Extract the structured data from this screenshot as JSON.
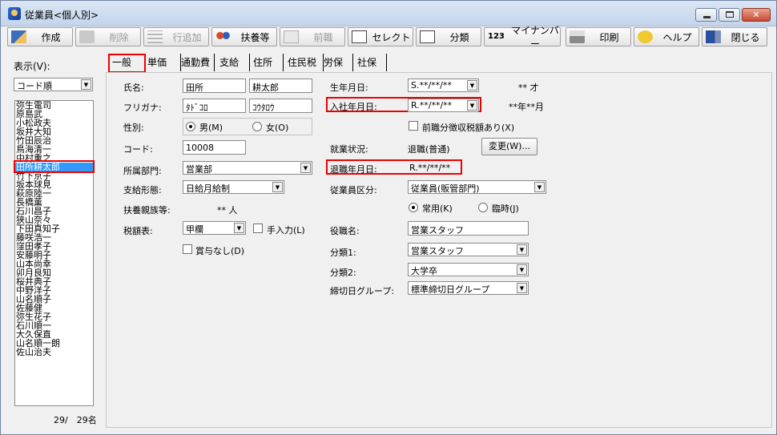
{
  "window": {
    "title": "従業員<個人別>",
    "close_glyph": "✕"
  },
  "toolbar": [
    {
      "name": "create-button",
      "label": "作成",
      "icon": "pencil-icon",
      "enabled": true
    },
    {
      "name": "delete-button",
      "label": "削除",
      "icon": "trash-icon",
      "enabled": false
    },
    {
      "name": "add-row-button",
      "label": "行追加",
      "icon": "grid-icon",
      "enabled": false
    },
    {
      "name": "dependents-button",
      "label": "扶養等",
      "icon": "people-icon",
      "enabled": true
    },
    {
      "name": "previous-job-button",
      "label": "前職",
      "icon": "document-icon",
      "enabled": false
    },
    {
      "name": "select-button",
      "label": "セレクト",
      "icon": "select-icon",
      "enabled": true
    },
    {
      "name": "classify-button",
      "label": "分類",
      "icon": "classify-icon",
      "enabled": true
    },
    {
      "name": "mynumber-button",
      "label": "マイナンバー",
      "icon": "mynumber-icon",
      "enabled": true
    },
    {
      "name": "print-button",
      "label": "印刷",
      "icon": "printer-icon",
      "enabled": true
    },
    {
      "name": "help-button",
      "label": "ヘルプ",
      "icon": "question-icon",
      "enabled": true
    },
    {
      "name": "close-window-button",
      "label": "閉じる",
      "icon": "exit-door-icon",
      "enabled": true
    }
  ],
  "icon_text": {
    "mynumber": "123"
  },
  "left": {
    "display_label": "表示(V):",
    "sort_value": "コード順",
    "employees": [
      "弥生電司",
      "原島武",
      "小松政夫",
      "坂井大知",
      "竹田辰治",
      "鳥海清一",
      "中村重之",
      "田所耕太郎",
      "竹下京子",
      "坂本球見",
      "萩原陸一",
      "長橋薫",
      "石川昌子",
      "狭山奈々",
      "下田真知子",
      "藤咲浩一",
      "窪田孝子",
      "安藤明子",
      "山本尚幸",
      "卯月良知",
      "桜井典子",
      "中野洋子",
      "山名順子",
      "佐藤健",
      "弥生花子",
      "石川順一",
      "大久保直",
      "山名順一朗",
      "佐山治夫"
    ],
    "selected_index": 7,
    "count_text": "29/　29名"
  },
  "tabs": [
    "一般",
    "単価",
    "通勤費",
    "支給",
    "住所",
    "住民税",
    "労保",
    "社保"
  ],
  "form": {
    "name_label": "氏名:",
    "last_name": "田所",
    "first_name": "耕太郎",
    "furigana_label": "フリガナ:",
    "furi_last": "ﾀﾄﾞｺﾛ",
    "furi_first": "ｺｳﾀﾛｳ",
    "gender_label": "性別:",
    "gender_male": "男(M)",
    "gender_female": "女(O)",
    "code_label": "コード:",
    "code": "10008",
    "dept_label": "所属部門:",
    "dept": "営業部",
    "paytype_label": "支給形態:",
    "paytype": "日給月給制",
    "dependents_label": "扶養親族等:",
    "dependents": "** 人",
    "tax_label": "税額表:",
    "tax": "甲欄",
    "manual_label": "手入力(L)",
    "nobonus_label": "賞与なし(D)",
    "birth_label": "生年月日:",
    "birth": "S.**/**/**",
    "age": "** 才",
    "hire_label": "入社年月日:",
    "hire": "R.**/**/**",
    "tenure": "**年**月",
    "prevwithhold_label": "前職分徴収税額あり(X)",
    "status_label": "就業状況:",
    "status": "退職(普通)",
    "change_btn": "変更(W)...",
    "retire_label": "退職年月日:",
    "retire": "R.**/**/**",
    "emptype_label": "従業員区分:",
    "emptype": "従業員(販管部門)",
    "regular_label": "常用(K)",
    "temporary_label": "臨時(J)",
    "position_label": "役職名:",
    "position": "営業スタッフ",
    "cat1_label": "分類1:",
    "cat1": "営業スタッフ",
    "cat2_label": "分類2:",
    "cat2": "大学卒",
    "cutoff_label": "締切日グループ:",
    "cutoff": "標準締切日グループ"
  }
}
